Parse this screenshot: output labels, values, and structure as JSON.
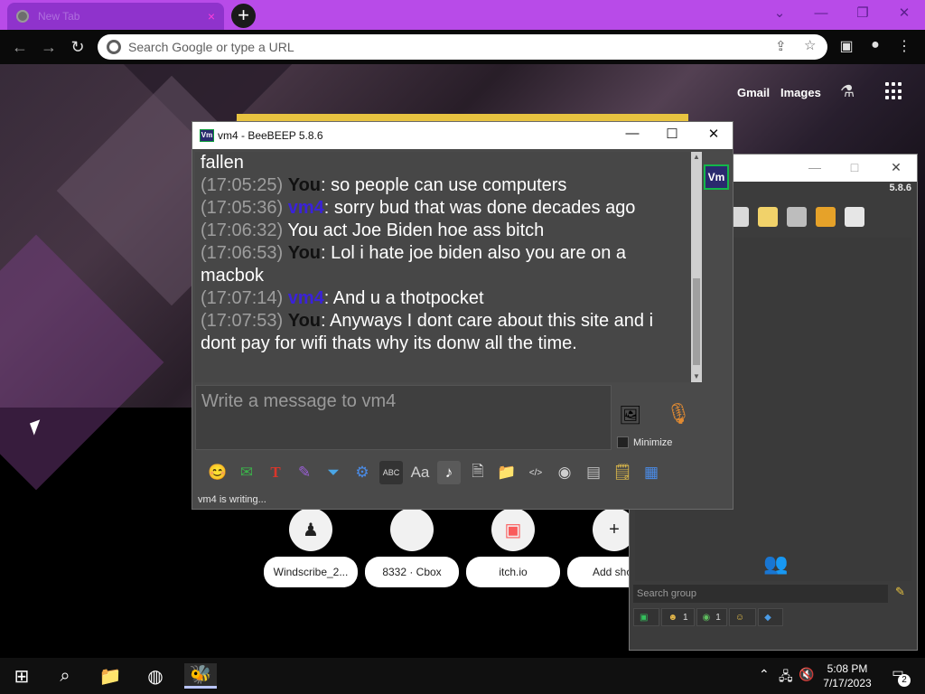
{
  "browser": {
    "tab_title": "New Tab",
    "tab_close": "×",
    "new_tab": "+",
    "omnibox_placeholder": "Search Google or type a URL",
    "window_controls": {
      "collapse": "⌄",
      "minimize": "—",
      "restore": "❐",
      "close": "✕"
    }
  },
  "newtab": {
    "links": {
      "gmail": "Gmail",
      "images": "Images"
    },
    "shortcuts": [
      {
        "label": "Windscribe_2...",
        "icon": "windscribe-icon"
      },
      {
        "label": "8332 · Cbox",
        "icon": "blank-icon"
      },
      {
        "label": "itch.io",
        "icon": "itchio-icon"
      },
      {
        "label": "Add shor",
        "icon": "plus-icon"
      }
    ]
  },
  "chat_window": {
    "title": "vm4 - BeeBEEP 5.8.6",
    "app_icon": "Vm",
    "avatar": "Vm",
    "messages": [
      {
        "text": "fallen"
      },
      {
        "time": "(17:05:25)",
        "sender": "You",
        "text": ": so people can use computers"
      },
      {
        "time": "(17:05:36)",
        "sender": "vm4",
        "text": ": sorry bud that was done decades ago"
      },
      {
        "time": "(17:06:32)",
        "sender": "",
        "text": "    You act Joe Biden hoe ass bitch"
      },
      {
        "time": "(17:06:53)",
        "sender": "You",
        "text": ": Lol i hate joe biden also you are on a macbok"
      },
      {
        "time": "(17:07:14)",
        "sender": "vm4",
        "text": ": And u a thotpocket"
      },
      {
        "time": "(17:07:53)",
        "sender": "You",
        "text": ": Anyways I dont care about this site and i dont pay for wifi thats why its donw all the time."
      }
    ],
    "input_placeholder": "Write a message to vm4",
    "minimize_label": "Minimize",
    "status": "vm4 is writing..."
  },
  "beebeep_main": {
    "version": "5.8.6",
    "search_placeholder": "Search group",
    "tabs": [
      {
        "icon": "chat-icon",
        "count": ""
      },
      {
        "icon": "users-icon",
        "count": "1"
      },
      {
        "icon": "messages-icon",
        "count": "1"
      },
      {
        "icon": "group-icon",
        "count": ""
      },
      {
        "icon": "share-icon",
        "count": ""
      }
    ]
  },
  "taskbar": {
    "time": "5:08 PM",
    "date": "7/17/2023",
    "notification_count": "2"
  },
  "colors": {
    "tab_strip": "#b84be8",
    "you_name": "#111111",
    "vm4_name": "#3a22d9",
    "timestamp": "#9e9e9e"
  }
}
